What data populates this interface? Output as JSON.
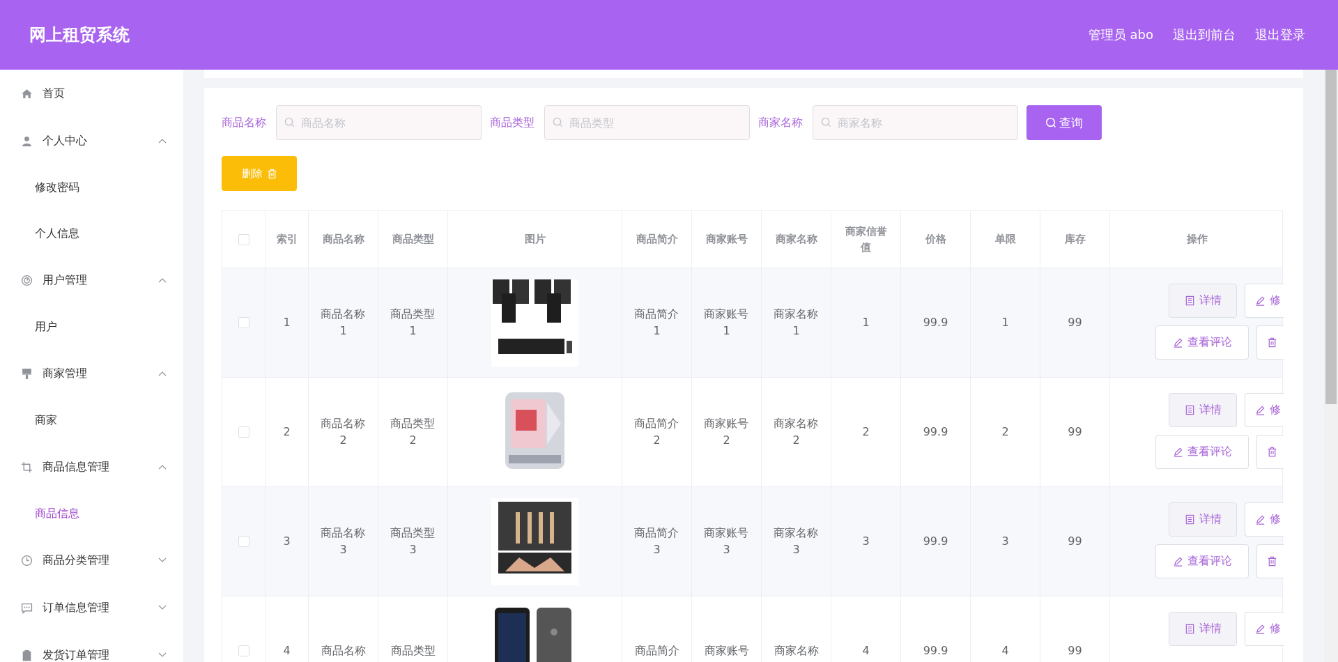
{
  "header": {
    "title": "网上租贸系统",
    "user": "管理员 abo",
    "links": [
      "退出到前台",
      "退出登录"
    ]
  },
  "sidebar": {
    "items": [
      {
        "kind": "link",
        "label": "首页"
      },
      {
        "kind": "group",
        "label": "个人中心",
        "expanded": true,
        "children": [
          {
            "label": "修改密码",
            "selected": false
          },
          {
            "label": "个人信息",
            "selected": false
          }
        ]
      },
      {
        "kind": "group",
        "label": "用户管理",
        "expanded": true,
        "children": [
          {
            "label": "用户",
            "selected": false
          }
        ]
      },
      {
        "kind": "group",
        "label": "商家管理",
        "expanded": true,
        "children": [
          {
            "label": "商家",
            "selected": false
          }
        ]
      },
      {
        "kind": "group",
        "label": "商品信息管理",
        "expanded": true,
        "children": [
          {
            "label": "商品信息",
            "selected": true
          }
        ]
      },
      {
        "kind": "group",
        "label": "商品分类管理",
        "expanded": false
      },
      {
        "kind": "group",
        "label": "订单信息管理",
        "expanded": false
      },
      {
        "kind": "group",
        "label": "发货订单管理",
        "expanded": false
      }
    ]
  },
  "filters": [
    {
      "label": "商品名称",
      "placeholder": "商品名称"
    },
    {
      "label": "商品类型",
      "placeholder": "商品类型"
    },
    {
      "label": "商家名称",
      "placeholder": "商家名称"
    }
  ],
  "search_button": "查询",
  "delete_button": "删除",
  "table": {
    "all_checked": false,
    "columns": [
      "索引",
      "商品名称",
      "商品类型",
      "图片",
      "商品简介",
      "商家账号",
      "商家名称",
      "商家信誉值",
      "价格",
      "单限",
      "库存",
      "操作"
    ],
    "rows": [
      {
        "checked": false,
        "cells": [
          "1",
          "商品名称1",
          "商品类型1",
          null,
          "商品简介1",
          "商家账号1",
          "商家名称1",
          "1",
          "99.9",
          "1",
          "99"
        ],
        "actions": [
          {
            "kind": "detail",
            "label": "详情"
          },
          {
            "kind": "edit",
            "label": "修"
          },
          {
            "kind": "review",
            "label": "查看评论"
          },
          {
            "kind": "delete"
          }
        ]
      },
      {
        "checked": false,
        "cells": [
          "2",
          "商品名称2",
          "商品类型2",
          null,
          "商品简介2",
          "商家账号2",
          "商家名称2",
          "2",
          "99.9",
          "2",
          "99"
        ],
        "actions": [
          {
            "kind": "detail",
            "label": "详情"
          },
          {
            "kind": "edit",
            "label": "修"
          },
          {
            "kind": "review",
            "label": "查看评论"
          },
          {
            "kind": "delete"
          }
        ]
      },
      {
        "checked": false,
        "cells": [
          "3",
          "商品名称3",
          "商品类型3",
          null,
          "商品简介3",
          "商家账号3",
          "商家名称3",
          "3",
          "99.9",
          "3",
          "99"
        ],
        "actions": [
          {
            "kind": "detail",
            "label": "详情"
          },
          {
            "kind": "edit",
            "label": "修"
          },
          {
            "kind": "review",
            "label": "查看评论"
          },
          {
            "kind": "delete"
          }
        ]
      },
      {
        "checked": false,
        "cells": [
          "4",
          "商品名称",
          "商品类型",
          null,
          "商品简介",
          "商家账号",
          "商家名称",
          "4",
          "99.9",
          "4",
          "99"
        ],
        "actions": [
          {
            "kind": "detail",
            "label": "详情"
          },
          {
            "kind": "edit",
            "label": "修"
          }
        ]
      }
    ]
  }
}
